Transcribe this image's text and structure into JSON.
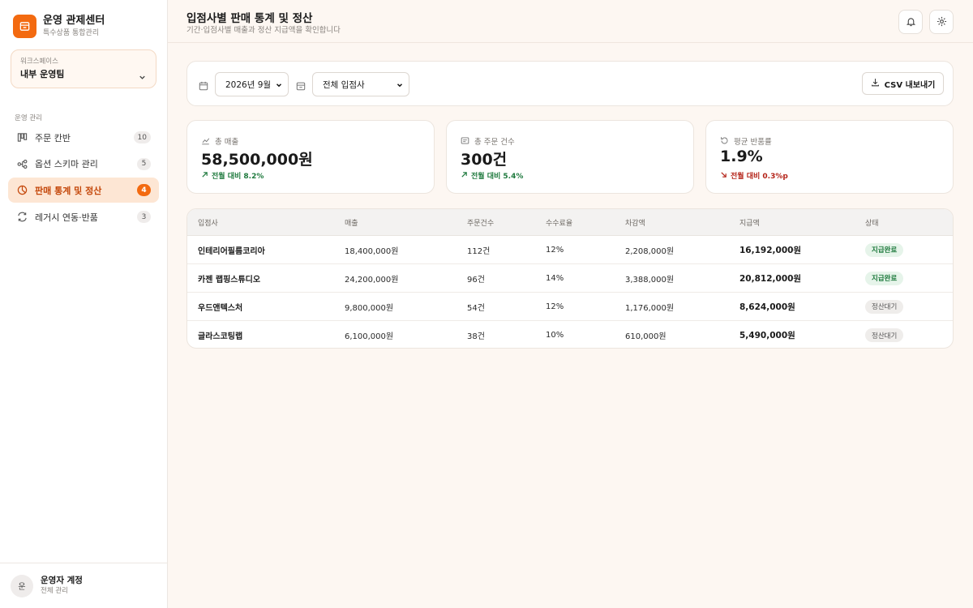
{
  "brand": {
    "title": "운영 관제센터",
    "subtitle": "특수상품 통합관리"
  },
  "workspace": {
    "label": "워크스페이스",
    "value": "내부 운영팀"
  },
  "nav": {
    "section": "운영 관리",
    "items": [
      {
        "label": "주문 칸반",
        "badge": "10",
        "icon": "kanban-icon"
      },
      {
        "label": "옵션 스키마 관리",
        "badge": "5",
        "icon": "schema-icon"
      },
      {
        "label": "판매 통계 및 정산",
        "badge": "4",
        "icon": "pie-chart-icon",
        "active": true
      },
      {
        "label": "레거시 연동·반품",
        "badge": "3",
        "icon": "sync-icon"
      }
    ]
  },
  "user": {
    "avatar": "운",
    "name": "운영자 계정",
    "role": "전체 관리"
  },
  "header": {
    "title": "입점사별 판매 통계 및 정산",
    "subtitle": "기간·입점사별 매출과 정산 지급액을 확인합니다"
  },
  "filters": {
    "period": "2026년 9월",
    "vendor": "전체 입점사",
    "csv_label": "CSV 내보내기"
  },
  "stats": [
    {
      "label": "총 매출",
      "value": "58,500,000원",
      "delta": "전월 대비 8.2%",
      "direction": "up",
      "icon": "trend-icon"
    },
    {
      "label": "총 주문 건수",
      "value": "300건",
      "delta": "전월 대비 5.4%",
      "direction": "up",
      "icon": "receipt-icon"
    },
    {
      "label": "평균 반품률",
      "value": "1.9%",
      "delta": "전월 대비 0.3%p",
      "direction": "down",
      "icon": "return-icon"
    }
  ],
  "table": {
    "columns": [
      "입점사",
      "매출",
      "주문건수",
      "수수료율",
      "차감액",
      "지급액",
      "상태"
    ],
    "rows": [
      {
        "vendor": "인테리어필름코리아",
        "sales": "18,400,000원",
        "orders": "112건",
        "rate": "12%",
        "deduction": "2,208,000원",
        "payout": "16,192,000원",
        "status": "지급완료",
        "status_type": "done"
      },
      {
        "vendor": "카젠 랩핑스튜디오",
        "sales": "24,200,000원",
        "orders": "96건",
        "rate": "14%",
        "deduction": "3,388,000원",
        "payout": "20,812,000원",
        "status": "지급완료",
        "status_type": "done"
      },
      {
        "vendor": "우드앤텍스처",
        "sales": "9,800,000원",
        "orders": "54건",
        "rate": "12%",
        "deduction": "1,176,000원",
        "payout": "8,624,000원",
        "status": "정산대기",
        "status_type": "wait"
      },
      {
        "vendor": "글라스코팅랩",
        "sales": "6,100,000원",
        "orders": "38건",
        "rate": "10%",
        "deduction": "610,000원",
        "payout": "5,490,000원",
        "status": "정산대기",
        "status_type": "wait"
      }
    ]
  },
  "colors": {
    "accent": "#f36a10",
    "success": "#1f7a3e",
    "danger": "#b42318"
  }
}
